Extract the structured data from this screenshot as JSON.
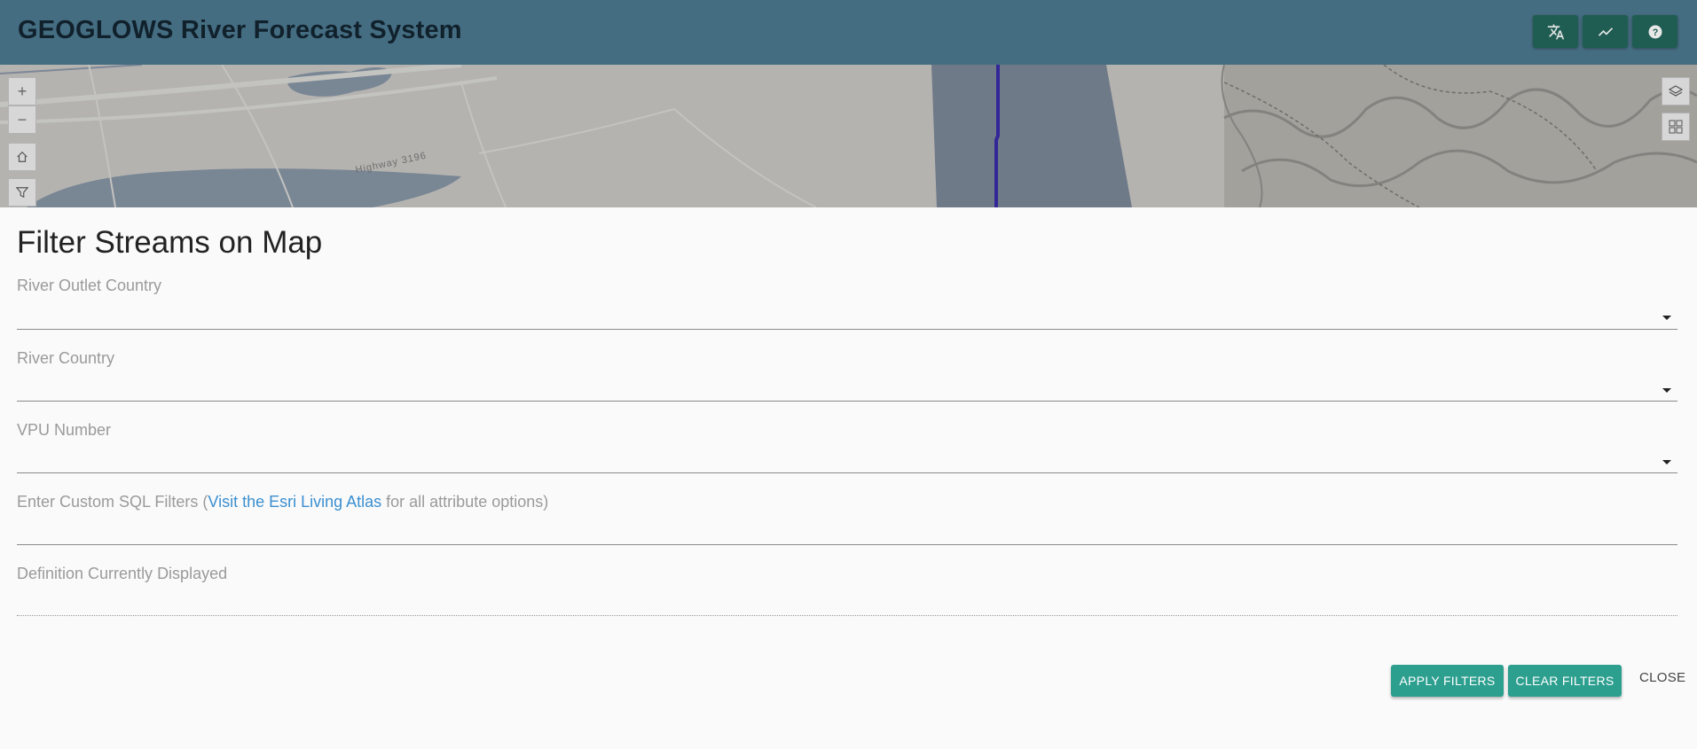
{
  "header": {
    "title": "GEOGLOWS River Forecast System",
    "buttons": [
      {
        "icon": "translate-icon",
        "name": "language"
      },
      {
        "icon": "trend-chart-icon",
        "name": "charts"
      },
      {
        "icon": "help-icon",
        "name": "help"
      }
    ],
    "background": "#456d82",
    "button_color": "#1f5d52"
  },
  "map": {
    "road_label": "Highway 3196",
    "controls": {
      "zoom_in": "+",
      "zoom_out": "−"
    }
  },
  "panel": {
    "title": "Filter Streams on Map",
    "fields": {
      "outlet_country": {
        "label": "River Outlet Country",
        "value": ""
      },
      "river_country": {
        "label": "River Country",
        "value": ""
      },
      "vpu_number": {
        "label": "VPU Number",
        "value": ""
      },
      "custom_sql": {
        "label_prefix": "Enter Custom SQL Filters (",
        "link_text": "Visit the Esri Living Atlas",
        "label_suffix": " for all attribute options)",
        "value": ""
      },
      "definition": {
        "label": "Definition Currently Displayed",
        "value": ""
      }
    },
    "buttons": {
      "apply": "APPLY FILTERS",
      "clear": "CLEAR FILTERS",
      "close": "CLOSE"
    },
    "accent": "#2d9f8f",
    "link_color": "#3a8fd1"
  }
}
